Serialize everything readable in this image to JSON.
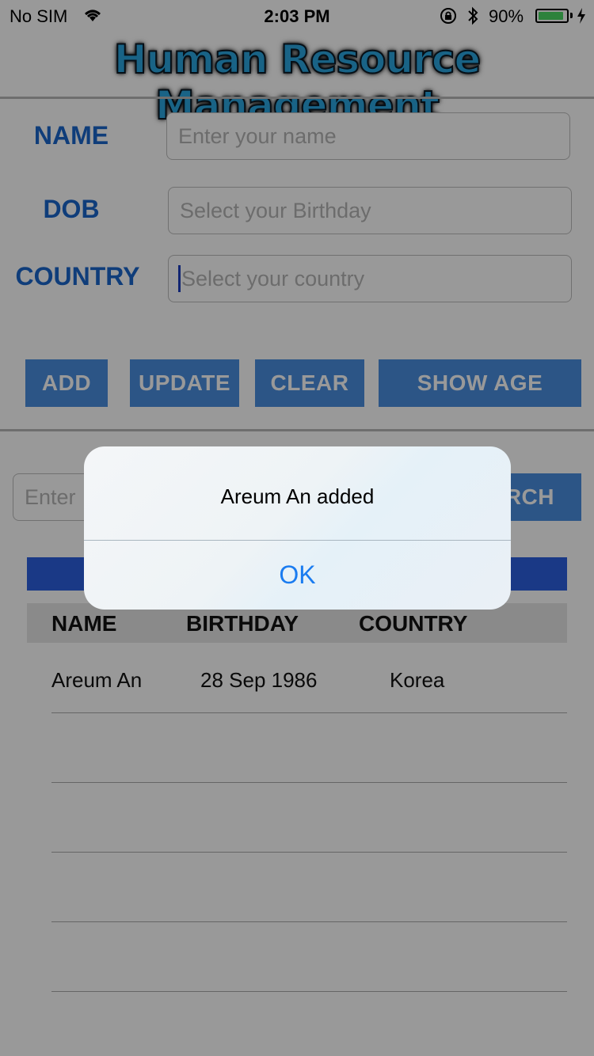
{
  "status_bar": {
    "carrier": "No SIM",
    "time": "2:03 PM",
    "battery_percent": "90%",
    "battery_level": 0.9,
    "icons": [
      "wifi-icon",
      "rotation-lock-icon",
      "bluetooth-icon",
      "battery-icon",
      "charging-bolt-icon"
    ]
  },
  "app": {
    "title": "Human Resource Management"
  },
  "form": {
    "name_label": "NAME",
    "name_placeholder": "Enter your name",
    "dob_label": "DOB",
    "dob_placeholder": "Select your Birthday",
    "country_label": "COUNTRY",
    "country_placeholder": "Select your country"
  },
  "buttons": {
    "add": "ADD",
    "update": "UPDATE",
    "clear": "CLEAR",
    "show_age": "SHOW AGE"
  },
  "search": {
    "input_visible_text": "Enter",
    "button_visible_text": "RCH"
  },
  "table": {
    "columns": [
      "NAME",
      "BIRTHDAY",
      "COUNTRY"
    ],
    "rows": [
      {
        "name": "Areum An",
        "birthday": "28 Sep 1986",
        "country": "Korea"
      }
    ]
  },
  "alert": {
    "message": "Areum An added",
    "ok_label": "OK"
  },
  "colors": {
    "accent_blue": "#1a66cc",
    "button_blue": "#4a8ee0",
    "table_bar_blue": "#2c5fe0",
    "alert_ok_blue": "#1a7cf0",
    "title_cyan": "#2aa6e0"
  }
}
